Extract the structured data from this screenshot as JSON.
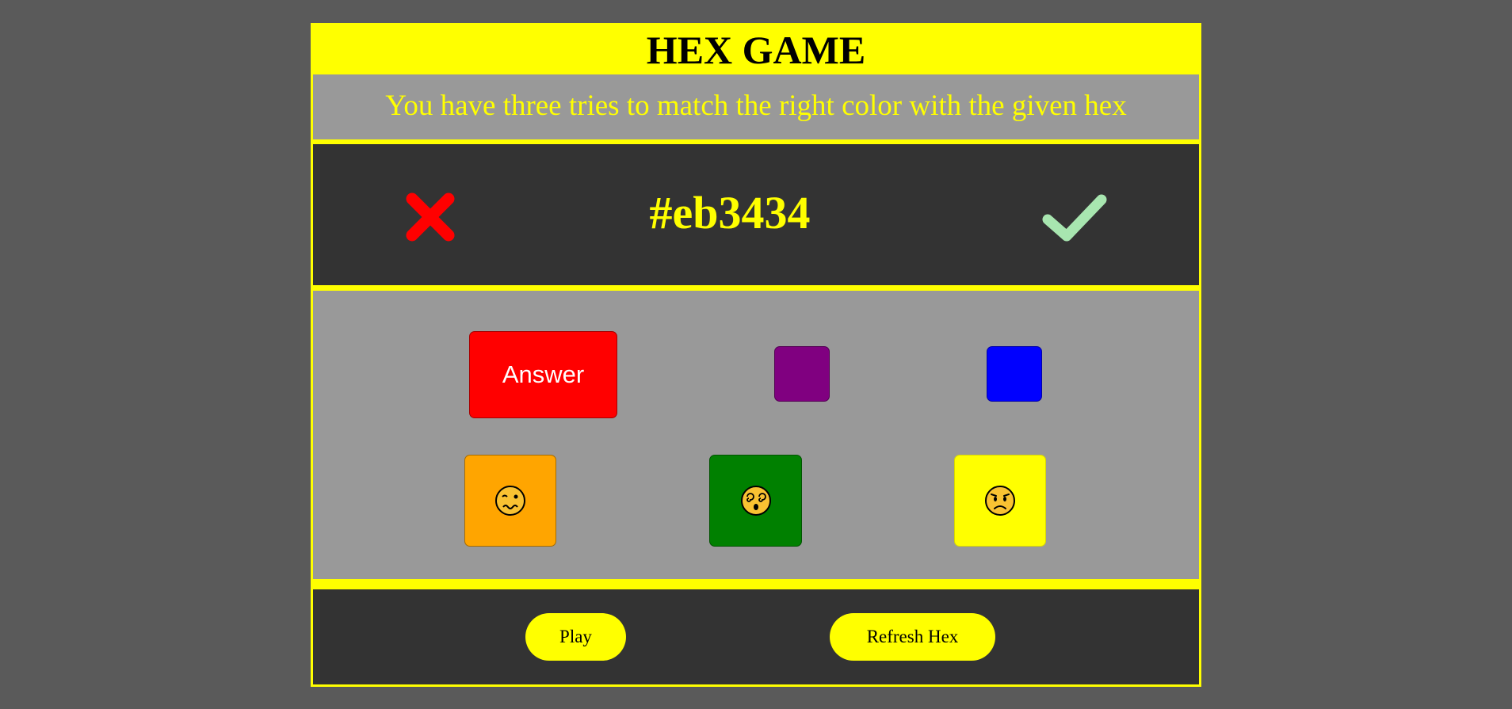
{
  "header": {
    "title": "HEX GAME"
  },
  "instructions": {
    "text": "You have three tries to match the right color with the given hex"
  },
  "hex_display": {
    "value": "#eb3434",
    "wrong_icon": "x-mark-icon",
    "correct_icon": "check-mark-icon"
  },
  "choices": {
    "answer_label": "Answer",
    "swatches": [
      {
        "name": "red",
        "color": "#ff0000",
        "label": "Answer"
      },
      {
        "name": "purple",
        "color": "#800080"
      },
      {
        "name": "blue",
        "color": "#0000ff"
      },
      {
        "name": "orange",
        "color": "#ffa500",
        "face": "woozy-face-icon"
      },
      {
        "name": "green",
        "color": "#008000",
        "face": "dizzy-face-icon"
      },
      {
        "name": "yellow",
        "color": "#ffff00",
        "face": "worried-face-icon"
      }
    ]
  },
  "controls": {
    "play_label": "Play",
    "refresh_label": "Refresh Hex"
  },
  "colors": {
    "accent": "#ffff00",
    "background": "#5a5a5a",
    "panel_dark": "#333333",
    "panel_light": "#999999",
    "wrong": "#ff0000",
    "correct": "#a8e6b0"
  }
}
